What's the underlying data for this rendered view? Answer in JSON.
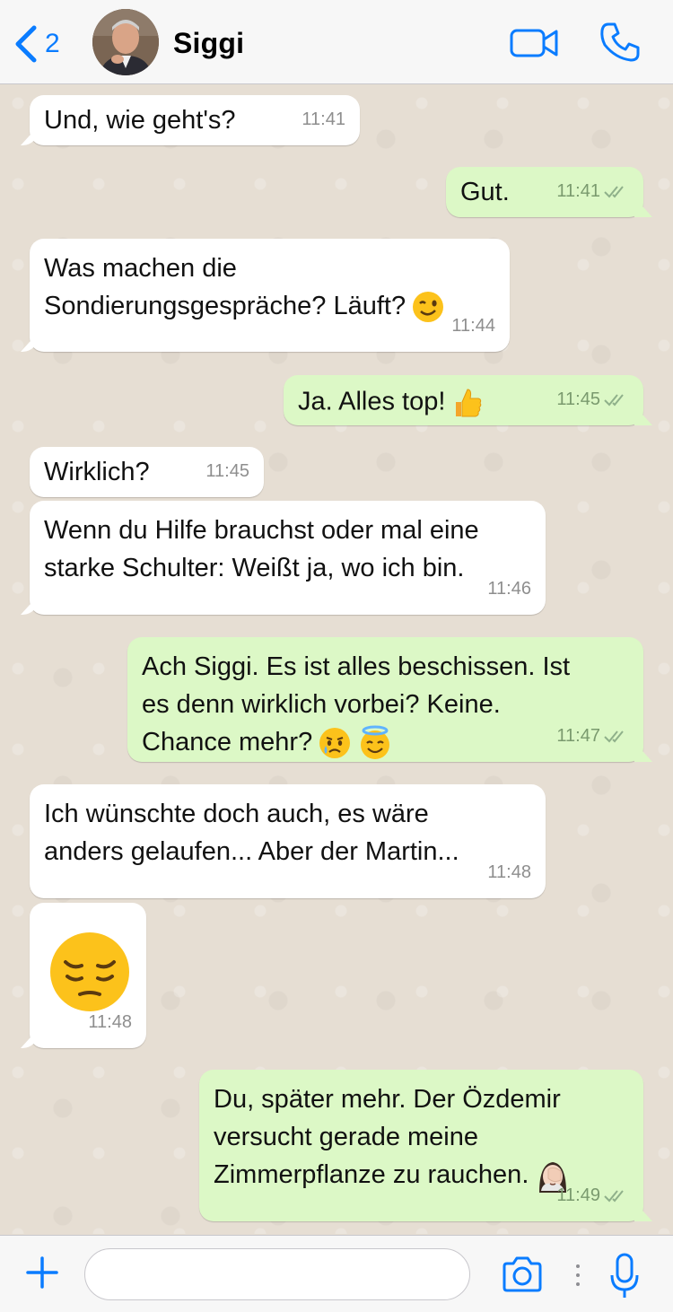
{
  "header": {
    "back_count": "2",
    "contact_name": "Siggi"
  },
  "messages": [
    {
      "id": "m1",
      "direction": "in",
      "text": "Und, wie geht's?",
      "time": "11:41"
    },
    {
      "id": "m2",
      "direction": "out",
      "text": "Gut.",
      "time": "11:41",
      "status": "read"
    },
    {
      "id": "m3",
      "direction": "in",
      "text": "Was machen die\nSondierungsgespräche? Läuft?",
      "emoji": "winking-face",
      "time": "11:44"
    },
    {
      "id": "m4",
      "direction": "out",
      "text": "Ja. Alles top!",
      "emoji": "thumbs-up",
      "time": "11:45",
      "status": "read"
    },
    {
      "id": "m5",
      "direction": "in",
      "text": "Wirklich?",
      "time": "11:45"
    },
    {
      "id": "m6",
      "direction": "in",
      "text": "Wenn du Hilfe brauchst oder mal eine\nstarke Schulter: Weißt ja, wo ich bin.",
      "time": "11:46"
    },
    {
      "id": "m7",
      "direction": "out",
      "text": "Ach Siggi. Es ist alles beschissen. Ist\nes denn wirklich vorbei? Keine.\nChance mehr?",
      "emoji": "crying-face,smiling-face-with-halo",
      "time": "11:47",
      "status": "read"
    },
    {
      "id": "m8",
      "direction": "in",
      "text": "Ich wünschte doch auch, es wäre\nanders gelaufen... Aber der Martin...",
      "time": "11:48"
    },
    {
      "id": "m9",
      "direction": "in",
      "text": "",
      "emoji": "pensive-face",
      "time": "11:48"
    },
    {
      "id": "m10",
      "direction": "out",
      "text": "Du, später mehr. Der Özdemir\nversucht gerade meine\nZimmerpflanze zu rauchen.",
      "emoji": "woman-facepalming",
      "time": "11:49",
      "status": "read"
    }
  ],
  "input": {
    "placeholder": ""
  },
  "colors": {
    "accent": "#0a7cff",
    "incoming_bubble": "#ffffff",
    "outgoing_bubble": "#dcf8c6",
    "chat_background": "#e6ded3",
    "read_ticks": "#8fb08a"
  },
  "icons": {
    "back": "chevron-left-icon",
    "video": "video-camera-icon",
    "call": "phone-icon",
    "attach": "plus-icon",
    "camera": "camera-icon",
    "voice": "microphone-icon",
    "status": "double-check-icon"
  }
}
